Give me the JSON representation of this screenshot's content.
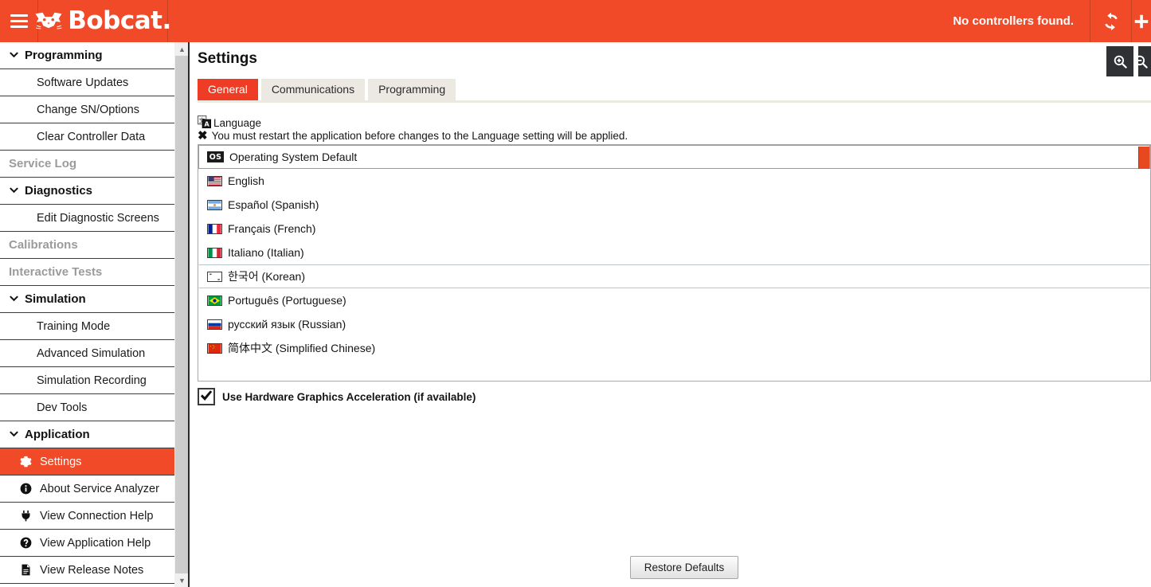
{
  "topbar": {
    "menu_icon": "hamburger-icon",
    "brand": "Bobcat",
    "brand_dot": ".",
    "status": "No controllers found.",
    "refresh_icon": "refresh-icon",
    "add_icon": "plus-icon"
  },
  "sidebar": {
    "groups": [
      {
        "label": "Programming",
        "items": [
          {
            "label": "Software Updates",
            "state": "normal"
          },
          {
            "label": "Change SN/Options",
            "state": "normal"
          },
          {
            "label": "Clear Controller Data",
            "state": "normal"
          },
          {
            "label": "Service Log",
            "state": "disabled"
          }
        ]
      },
      {
        "label": "Diagnostics",
        "items": [
          {
            "label": "Edit Diagnostic Screens",
            "state": "normal"
          },
          {
            "label": "Calibrations",
            "state": "disabled"
          },
          {
            "label": "Interactive Tests",
            "state": "disabled"
          }
        ]
      },
      {
        "label": "Simulation",
        "items": [
          {
            "label": "Training Mode",
            "state": "normal"
          },
          {
            "label": "Advanced Simulation",
            "state": "normal"
          },
          {
            "label": "Simulation Recording",
            "state": "normal"
          },
          {
            "label": "Dev Tools",
            "state": "normal"
          }
        ]
      },
      {
        "label": "Application",
        "items": [
          {
            "label": "Settings",
            "state": "active",
            "icon": "gear-icon"
          },
          {
            "label": "About Service Analyzer",
            "state": "normal",
            "icon": "info-icon"
          },
          {
            "label": "View Connection Help",
            "state": "normal",
            "icon": "plug-icon"
          },
          {
            "label": "View Application Help",
            "state": "normal",
            "icon": "question-icon"
          },
          {
            "label": "View Release Notes",
            "state": "normal",
            "icon": "document-icon"
          }
        ]
      }
    ]
  },
  "main": {
    "title": "Settings",
    "zoom_in_icon": "zoom-in-icon",
    "zoom_out_icon": "zoom-out-icon",
    "tabs": [
      {
        "label": "General",
        "active": true
      },
      {
        "label": "Communications",
        "active": false
      },
      {
        "label": "Programming",
        "active": false
      }
    ],
    "language": {
      "section_label": "Language",
      "section_icon": "language-icon",
      "restart_note": "You must restart the application before changes to the Language setting will be applied.",
      "restart_icon": "x-mark-icon",
      "options": [
        {
          "label": "Operating System Default",
          "icon": "os-badge",
          "state": "selected"
        },
        {
          "label": "English",
          "icon": "flag-us",
          "state": "normal"
        },
        {
          "label": "Español (Spanish)",
          "icon": "flag-ar",
          "state": "normal"
        },
        {
          "label": "Français (French)",
          "icon": "flag-fr",
          "state": "normal"
        },
        {
          "label": "Italiano (Italian)",
          "icon": "flag-it",
          "state": "normal"
        },
        {
          "label": "한국어 (Korean)",
          "icon": "flag-kr",
          "state": "focused"
        },
        {
          "label": "Português (Portuguese)",
          "icon": "flag-br",
          "state": "normal"
        },
        {
          "label": "русский язык (Russian)",
          "icon": "flag-ru",
          "state": "normal"
        },
        {
          "label": "简体中文 (Simplified Chinese)",
          "icon": "flag-cn",
          "state": "normal"
        }
      ]
    },
    "hardware_acceleration": {
      "label": "Use Hardware Graphics Acceleration (if available)",
      "checked": true
    },
    "restore_defaults_label": "Restore Defaults"
  },
  "colors": {
    "brand_red": "#f04a28",
    "tab_active": "#ef3c25",
    "tab_inactive": "#ece9e3",
    "sidebar_active": "#f04a28",
    "zoom_button": "#2f3134"
  }
}
